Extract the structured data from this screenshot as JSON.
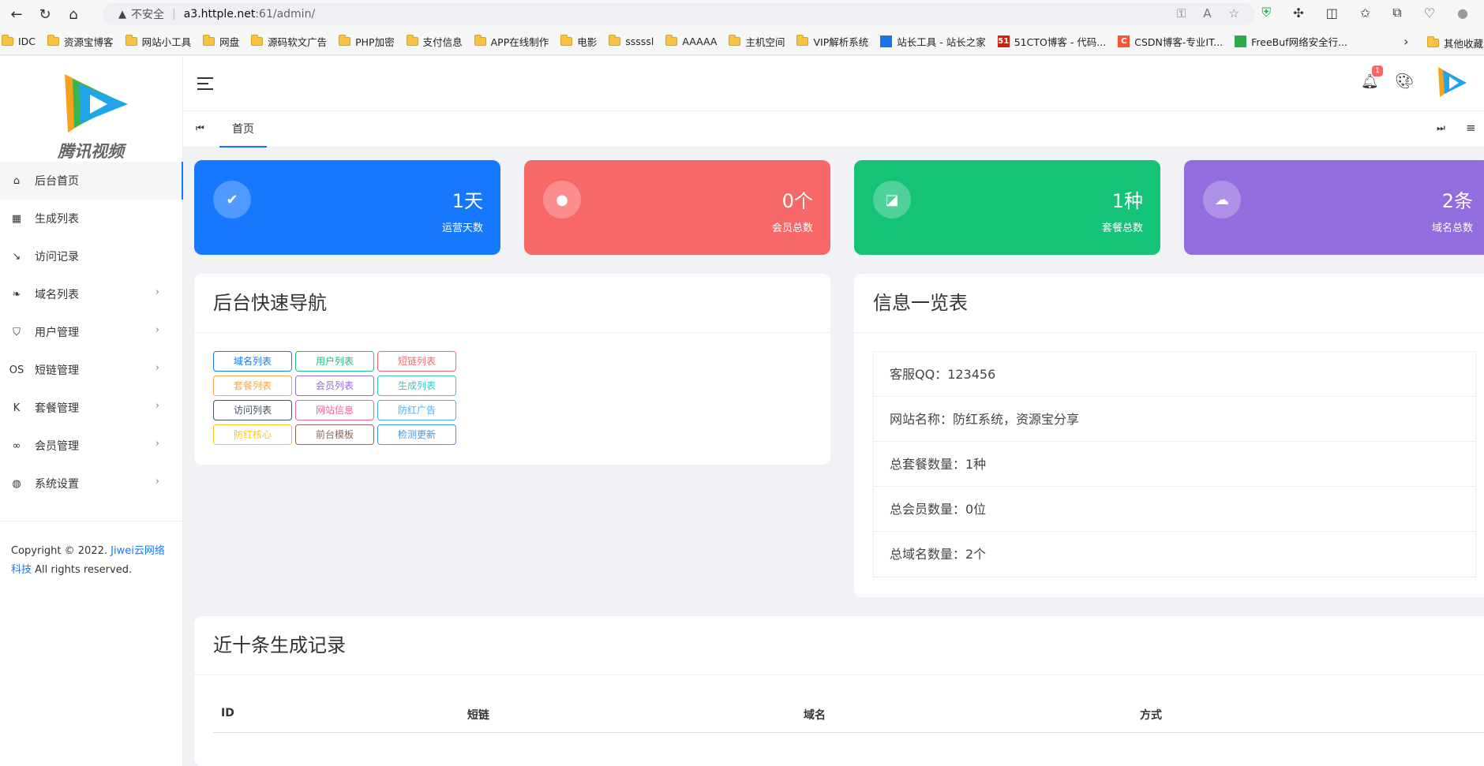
{
  "browser": {
    "insecure_label": "不安全",
    "url_host": "a3.httple.net",
    "url_path": ":61/admin/",
    "bookmarks": [
      {
        "label": "IDC",
        "type": "folder"
      },
      {
        "label": "资源宝博客",
        "type": "folder"
      },
      {
        "label": "网站小工具",
        "type": "folder"
      },
      {
        "label": "网盘",
        "type": "folder"
      },
      {
        "label": "源码软文广告",
        "type": "folder"
      },
      {
        "label": "PHP加密",
        "type": "folder"
      },
      {
        "label": "支付信息",
        "type": "folder"
      },
      {
        "label": "APP在线制作",
        "type": "folder"
      },
      {
        "label": "电影",
        "type": "folder"
      },
      {
        "label": "sssssl",
        "type": "folder"
      },
      {
        "label": "AAAAA",
        "type": "folder"
      },
      {
        "label": "主机空间",
        "type": "folder"
      },
      {
        "label": "VIP解析系统",
        "type": "folder"
      },
      {
        "label": "站长工具 - 站长之家",
        "type": "site",
        "icon_text": "",
        "color": "#1a73e8"
      },
      {
        "label": "51CTO博客 - 代码...",
        "type": "site",
        "icon_text": "51",
        "color": "#d81e06"
      },
      {
        "label": "CSDN博客-专业IT...",
        "type": "site",
        "icon_text": "C",
        "color": "#fc5531"
      },
      {
        "label": "FreeBuf网络安全行...",
        "type": "site",
        "icon_text": "",
        "color": "#2bab4a"
      }
    ],
    "other_bookmarks": "其他收藏"
  },
  "sidebar": {
    "logo_text": "腾讯视频",
    "items": [
      {
        "label": "后台首页",
        "icon": "dashboard-icon",
        "glyph": "⌂",
        "active": true,
        "has_children": false
      },
      {
        "label": "生成列表",
        "icon": "grid-icon",
        "glyph": "▦",
        "active": false,
        "has_children": false
      },
      {
        "label": "访问记录",
        "icon": "arrow-icon",
        "glyph": "↘",
        "active": false,
        "has_children": false
      },
      {
        "label": "域名列表",
        "icon": "leaf-icon",
        "glyph": "❧",
        "active": false,
        "has_children": true
      },
      {
        "label": "用户管理",
        "icon": "shield-user-icon",
        "glyph": "⛉",
        "active": false,
        "has_children": true
      },
      {
        "label": "短链管理",
        "icon": "os-icon",
        "glyph": "OS",
        "active": false,
        "has_children": true
      },
      {
        "label": "套餐管理",
        "icon": "k-icon",
        "glyph": "K",
        "active": false,
        "has_children": true
      },
      {
        "label": "会员管理",
        "icon": "glasses-icon",
        "glyph": "∞",
        "active": false,
        "has_children": true
      },
      {
        "label": "系统设置",
        "icon": "globe-icon",
        "glyph": "◍",
        "active": false,
        "has_children": true
      }
    ],
    "copyright_prefix": "Copyright © 2022.",
    "copyright_link": "Jiwei云网络科技",
    "copyright_suffix": "All rights reserved."
  },
  "header": {
    "notification_count": "1"
  },
  "tabs": {
    "home_label": "首页"
  },
  "stats": [
    {
      "value": "1天",
      "label": "运营天数",
      "color": "#1678ff",
      "icon": "shield-check-icon",
      "glyph": "✔"
    },
    {
      "value": "0个",
      "label": "会员总数",
      "color": "#f96868",
      "icon": "user-icon",
      "glyph": "●"
    },
    {
      "value": "1种",
      "label": "套餐总数",
      "color": "#15c377",
      "icon": "box-icon",
      "glyph": "◪"
    },
    {
      "value": "2条",
      "label": "域名总数",
      "color": "#926dde",
      "icon": "cloud-check-icon",
      "glyph": "☁"
    }
  ],
  "quick_nav": {
    "title": "后台快速导航",
    "buttons": [
      {
        "label": "域名列表",
        "color": "#1678ff"
      },
      {
        "label": "用户列表",
        "color": "#15c377"
      },
      {
        "label": "短链列表",
        "color": "#f96868"
      },
      {
        "label": "套餐列表",
        "color": "#faa64b"
      },
      {
        "label": "会员列表",
        "color": "#926dde"
      },
      {
        "label": "生成列表",
        "color": "#33cabb"
      },
      {
        "label": "访问列表",
        "color": "#465161"
      },
      {
        "label": "网站信息",
        "color": "#f96197"
      },
      {
        "label": "防红广告",
        "color": "#48b0f7"
      },
      {
        "label": "防红核心",
        "color": "#fcc525"
      },
      {
        "label": "前台模板",
        "color": "#8d6658"
      },
      {
        "label": "检测更新",
        "color": "#3c9cee"
      }
    ]
  },
  "info": {
    "title": "信息一览表",
    "rows": [
      "客服QQ：123456",
      "网站名称：防红系统，资源宝分享",
      "总套餐数量：1种",
      "总会员数量：0位",
      "总域名数量：2个"
    ]
  },
  "records": {
    "title": "近十条生成记录",
    "columns": [
      "ID",
      "短链",
      "域名",
      "方式"
    ]
  }
}
